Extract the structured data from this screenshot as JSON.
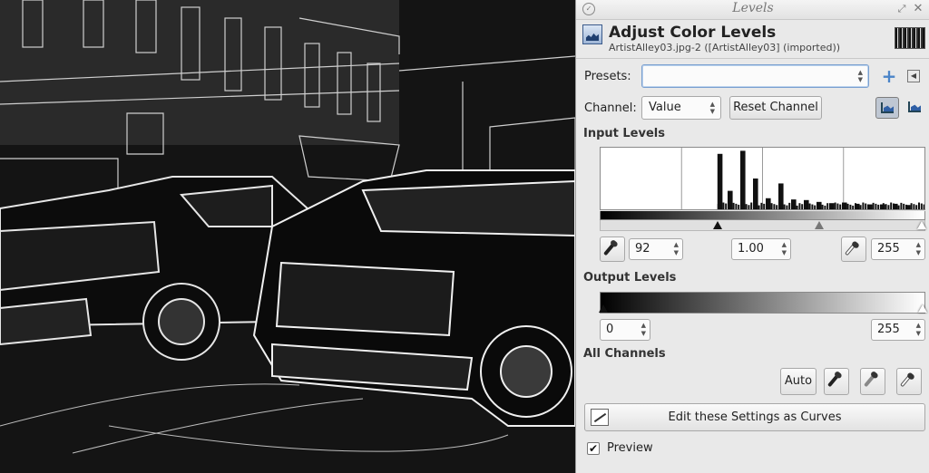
{
  "dialog": {
    "window_title": "Levels",
    "heading": "Adjust Color Levels",
    "subtitle": "ArtistAlley03.jpg-2 ([ArtistAlley03] (imported))",
    "presets": {
      "label": "Presets:",
      "value": ""
    },
    "channel": {
      "label": "Channel:",
      "value": "Value",
      "reset_label": "Reset Channel"
    },
    "input_levels": {
      "title": "Input Levels",
      "low": "92",
      "gamma": "1.00",
      "high": "255",
      "histogram_x": [
        0,
        92,
        100,
        110,
        120,
        130,
        140,
        150,
        160,
        170,
        180,
        190,
        200,
        210,
        220,
        230,
        240,
        255
      ],
      "histogram_y": [
        0.0,
        0.9,
        0.3,
        0.95,
        0.5,
        0.18,
        0.42,
        0.16,
        0.15,
        0.12,
        0.1,
        0.11,
        0.09,
        0.08,
        0.08,
        0.09,
        0.07,
        0.08
      ]
    },
    "output_levels": {
      "title": "Output Levels",
      "low": "0",
      "high": "255"
    },
    "all_channels": {
      "title": "All Channels",
      "auto_label": "Auto"
    },
    "curves_label": "Edit these Settings as Curves",
    "preview": {
      "label": "Preview",
      "checked": true
    },
    "icons": {
      "title_check": "check-icon",
      "maximize": "maximize-icon",
      "close": "close-icon",
      "levels": "levels-icon",
      "add_preset": "plus-icon",
      "preset_menu": "menu-icon",
      "linear": "linear-histogram-icon",
      "log": "log-histogram-icon",
      "black_picker": "black-point-picker-icon",
      "gray_picker": "gray-point-picker-icon",
      "white_picker": "white-point-picker-icon",
      "curves": "curves-icon"
    },
    "colors": {
      "accent": "#4a84c8",
      "panel": "#e9e9e9"
    }
  }
}
